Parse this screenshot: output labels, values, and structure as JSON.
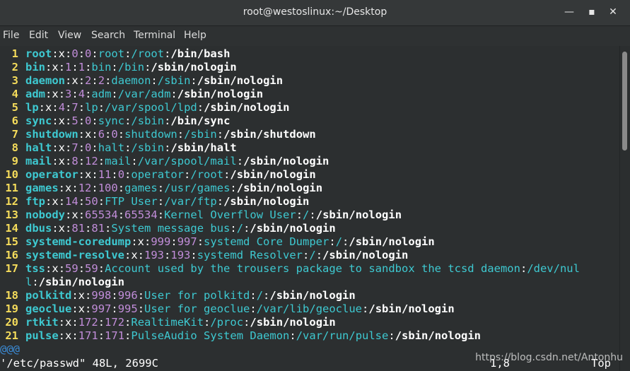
{
  "window": {
    "title": "root@westoslinux:~/Desktop",
    "controls": {
      "minimize": "minimize-icon",
      "maximize": "maximize-icon",
      "close": "close-icon"
    }
  },
  "menu": {
    "items": [
      "File",
      "Edit",
      "View",
      "Search",
      "Terminal",
      "Help"
    ]
  },
  "lines": [
    {
      "n": "1",
      "user": "root",
      "uid": "0",
      "gid": "0",
      "gecos": "root",
      "home": "/root",
      "shell": "/bin/bash"
    },
    {
      "n": "2",
      "user": "bin",
      "uid": "1",
      "gid": "1",
      "gecos": "bin",
      "home": "/bin",
      "shell": "/sbin/nologin"
    },
    {
      "n": "3",
      "user": "daemon",
      "uid": "2",
      "gid": "2",
      "gecos": "daemon",
      "home": "/sbin",
      "shell": "/sbin/nologin"
    },
    {
      "n": "4",
      "user": "adm",
      "uid": "3",
      "gid": "4",
      "gecos": "adm",
      "home": "/var/adm",
      "shell": "/sbin/nologin"
    },
    {
      "n": "5",
      "user": "lp",
      "uid": "4",
      "gid": "7",
      "gecos": "lp",
      "home": "/var/spool/lpd",
      "shell": "/sbin/nologin"
    },
    {
      "n": "6",
      "user": "sync",
      "uid": "5",
      "gid": "0",
      "gecos": "sync",
      "home": "/sbin",
      "shell": "/bin/sync"
    },
    {
      "n": "7",
      "user": "shutdown",
      "uid": "6",
      "gid": "0",
      "gecos": "shutdown",
      "home": "/sbin",
      "shell": "/sbin/shutdown"
    },
    {
      "n": "8",
      "user": "halt",
      "uid": "7",
      "gid": "0",
      "gecos": "halt",
      "home": "/sbin",
      "shell": "/sbin/halt"
    },
    {
      "n": "9",
      "user": "mail",
      "uid": "8",
      "gid": "12",
      "gecos": "mail",
      "home": "/var/spool/mail",
      "shell": "/sbin/nologin"
    },
    {
      "n": "10",
      "user": "operator",
      "uid": "11",
      "gid": "0",
      "gecos": "operator",
      "home": "/root",
      "shell": "/sbin/nologin"
    },
    {
      "n": "11",
      "user": "games",
      "uid": "12",
      "gid": "100",
      "gecos": "games",
      "home": "/usr/games",
      "shell": "/sbin/nologin"
    },
    {
      "n": "12",
      "user": "ftp",
      "uid": "14",
      "gid": "50",
      "gecos": "FTP User",
      "home": "/var/ftp",
      "shell": "/sbin/nologin"
    },
    {
      "n": "13",
      "user": "nobody",
      "uid": "65534",
      "gid": "65534",
      "gecos": "Kernel Overflow User",
      "home": "/",
      "shell": "/sbin/nologin"
    },
    {
      "n": "14",
      "user": "dbus",
      "uid": "81",
      "gid": "81",
      "gecos": "System message bus",
      "home": "/",
      "shell": "/sbin/nologin"
    },
    {
      "n": "15",
      "user": "systemd-coredump",
      "uid": "999",
      "gid": "997",
      "gecos": "systemd Core Dumper",
      "home": "/",
      "shell": "/sbin/nologin"
    },
    {
      "n": "16",
      "user": "systemd-resolve",
      "uid": "193",
      "gid": "193",
      "gecos": "systemd Resolver",
      "home": "/",
      "shell": "/sbin/nologin"
    },
    {
      "n": "17",
      "user": "tss",
      "uid": "59",
      "gid": "59",
      "gecos": "Account used by the trousers package to sandbox the tcsd daemon",
      "home": "/dev/nul",
      "shell": "l:/sbin/nologin",
      "wrap": true
    },
    {
      "n": "18",
      "user": "polkitd",
      "uid": "998",
      "gid": "996",
      "gecos": "User for polkitd",
      "home": "/",
      "shell": "/sbin/nologin"
    },
    {
      "n": "19",
      "user": "geoclue",
      "uid": "997",
      "gid": "995",
      "gecos": "User for geoclue",
      "home": "/var/lib/geoclue",
      "shell": "/sbin/nologin"
    },
    {
      "n": "20",
      "user": "rtkit",
      "uid": "172",
      "gid": "172",
      "gecos": "RealtimeKit",
      "home": "/proc",
      "shell": "/sbin/nologin"
    },
    {
      "n": "21",
      "user": "pulse",
      "uid": "171",
      "gid": "171",
      "gecos": "PulseAudio System Daemon",
      "home": "/var/run/pulse",
      "shell": "/sbin/nologin"
    }
  ],
  "cursor_marker": "@@@",
  "status": {
    "file": "'/etc/passwd\" 48L, 2699C",
    "position": "1,8",
    "scroll": "Top"
  },
  "watermark": "https://blog.csdn.net/Antonhu"
}
